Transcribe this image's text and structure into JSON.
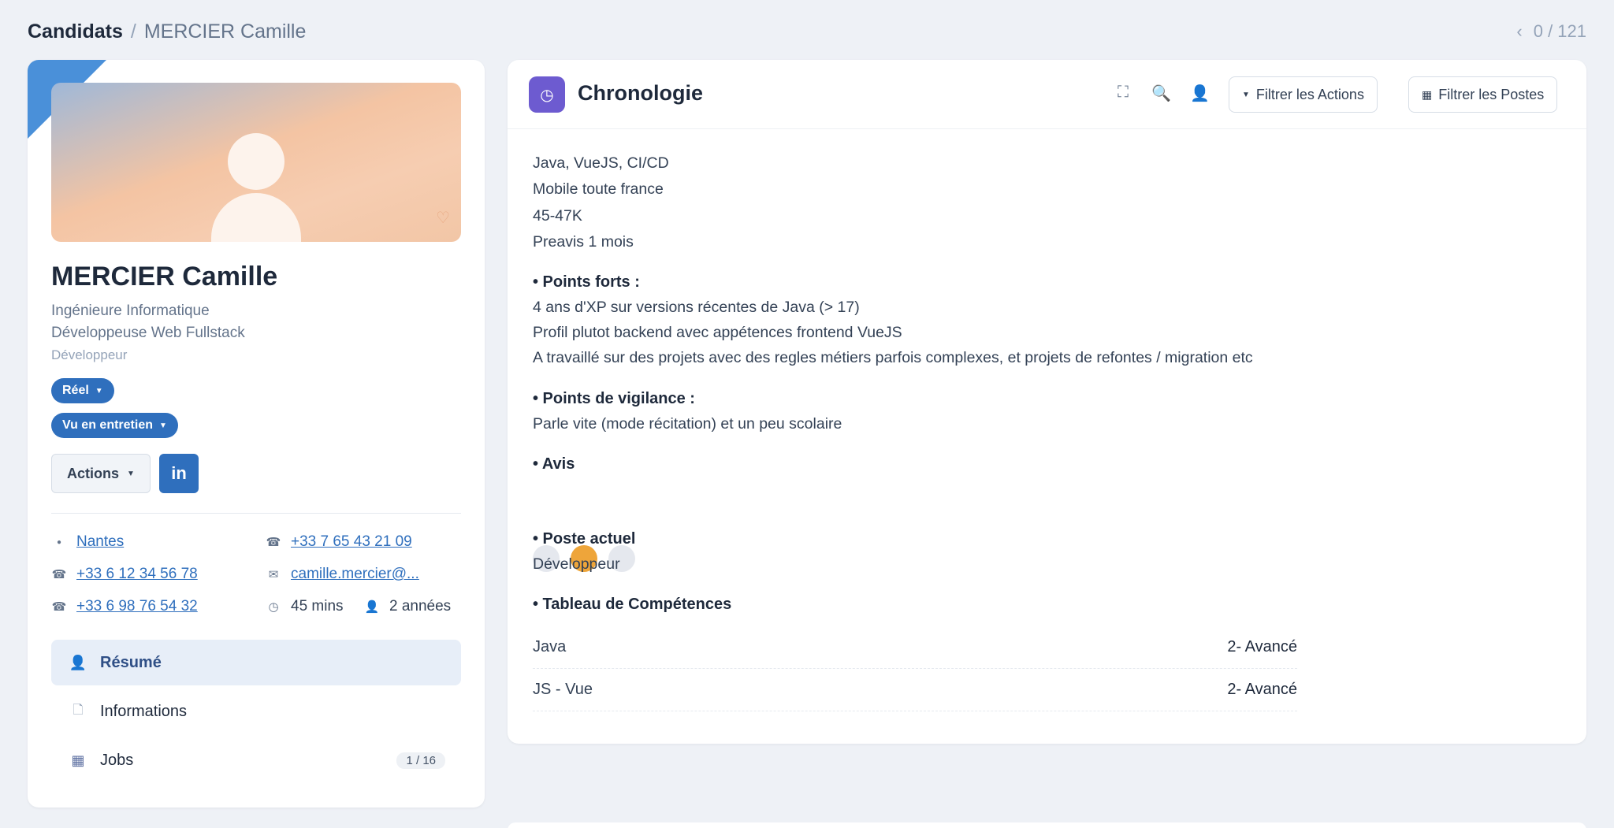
{
  "breadcrumb": {
    "root": "Candidats",
    "separator": "/",
    "current": "MERCIER Camille"
  },
  "pager": {
    "prev_icon": "chevron-left-icon",
    "text": "0 / 121"
  },
  "profile": {
    "name": "MERCIER Camille",
    "subtitle1": "Ingénieure Informatique",
    "subtitle2": "Développeuse Web Fullstack",
    "subtitle3": "Développeur",
    "status_pill": "Réel",
    "stage_pill": "Vu en entretien",
    "actions_label": "Actions",
    "linkedin_label": "in",
    "colors": {
      "accent": "#2f6fbd",
      "banner_start": "#9fb8d8",
      "banner_end": "#f4c4a3"
    }
  },
  "contacts": {
    "city": "Nantes",
    "phone_main": "+33 7 65 43 21 09",
    "phone_2": "+33 6 12 34 56 78",
    "email": "camille.mercier@...",
    "phone_3": "+33 6 98 76 54 32",
    "duration": "45 mins",
    "experience": "2 années"
  },
  "nav": {
    "resume": "Résumé",
    "informations": "Informations",
    "jobs": "Jobs",
    "jobs_badge": "1 / 16"
  },
  "timeline": {
    "title": "Chronologie",
    "filter_actions": "Filtrer les Actions",
    "filter_posts": "Filtrer les Postes",
    "lines": [
      "Java, VueJS, CI/CD",
      "Mobile toute france",
      "45-47K",
      "Preavis 1 mois"
    ],
    "strengths_title": "• Points forts :",
    "strengths": [
      "4 ans d'XP sur versions récentes de Java (> 17)",
      "Profil plutot backend avec appétences frontend VueJS",
      "A travaillé sur des projets avec des regles métiers parfois complexes, et projets de refontes / migration etc"
    ],
    "vigilance_title": "• Points de vigilance :",
    "vigilance": "Parle vite (mode récitation) et un peu scolaire",
    "avis_title": "• Avis",
    "avis_selected_index": 1,
    "poste_title": "• Poste actuel",
    "poste": "Développeur",
    "competences_title": "• Tableau de Compétences",
    "competences": [
      {
        "skill": "Java",
        "level": "2- Avancé"
      },
      {
        "skill": "JS - Vue",
        "level": "2- Avancé"
      }
    ]
  }
}
